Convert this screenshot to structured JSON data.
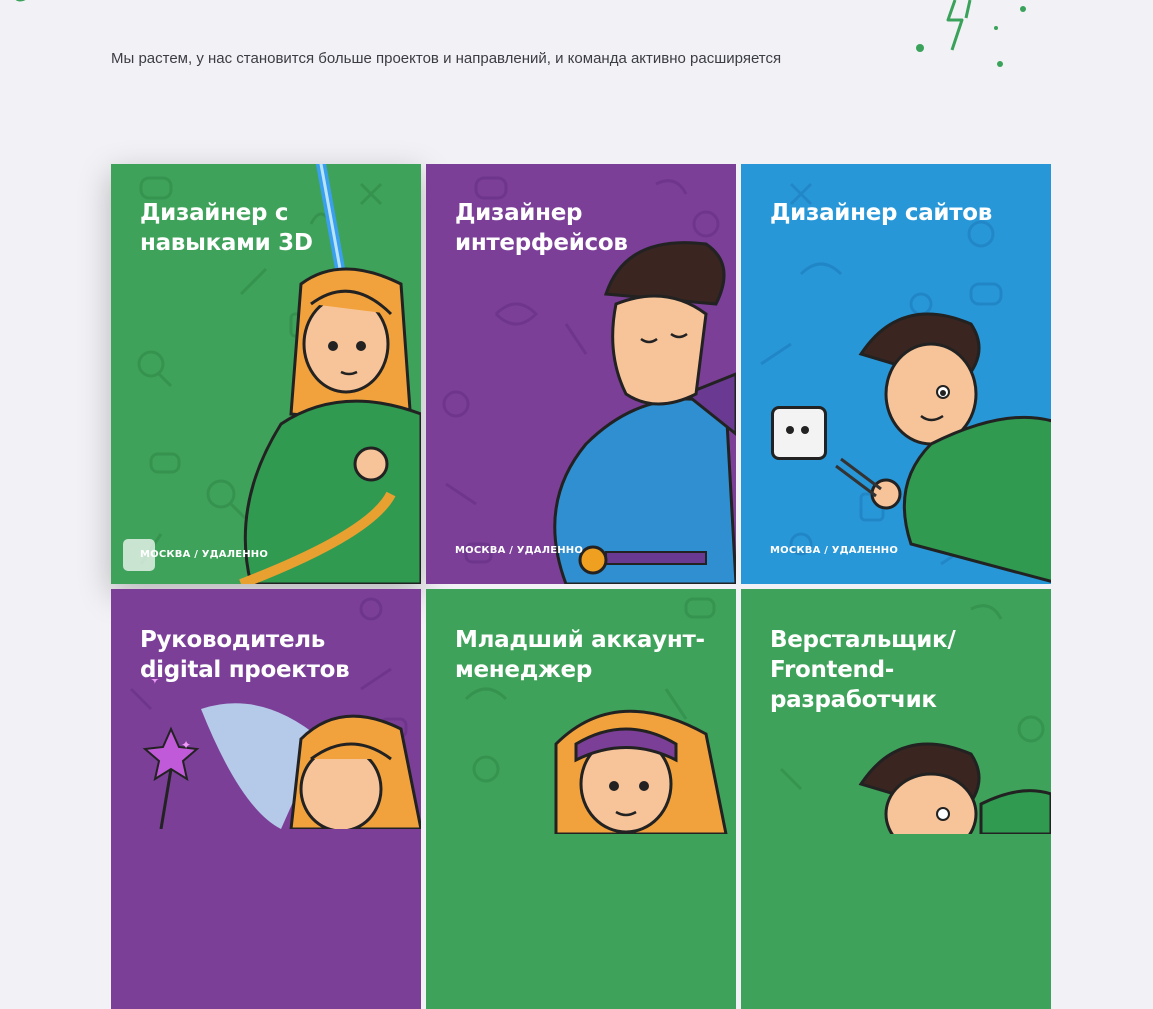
{
  "intro_text": "Мы растем, у нас становится больше проектов и направлений, и команда активно расширяется",
  "colors": {
    "green": "#3fa25a",
    "purple": "#7b3f98",
    "blue": "#2897d8",
    "accent_green": "#3aa25a"
  },
  "vacancies": [
    {
      "title": "Дизайнер с навыками 3D",
      "location": "МОСКВА / УДАЛЕННО",
      "color": "green",
      "character": "girl-with-lightsaber"
    },
    {
      "title": "Дизайнер интерфейсов",
      "location": "МОСКВА / УДАЛЕННО",
      "color": "purple",
      "character": "superhero"
    },
    {
      "title": "Дизайнер сайтов",
      "location": "МОСКВА / УДАЛЕННО",
      "color": "blue",
      "character": "boy-with-fork-and-socket"
    },
    {
      "title": "Руководитель digital проектов",
      "location": "",
      "color": "purple",
      "character": "fairy-with-wand"
    },
    {
      "title": "Младший аккаунт-менеджер",
      "location": "",
      "color": "green",
      "character": "girl-with-headband"
    },
    {
      "title": "Верстальщик/ Frontend-разработчик",
      "location": "",
      "color": "green",
      "character": "boy"
    }
  ]
}
